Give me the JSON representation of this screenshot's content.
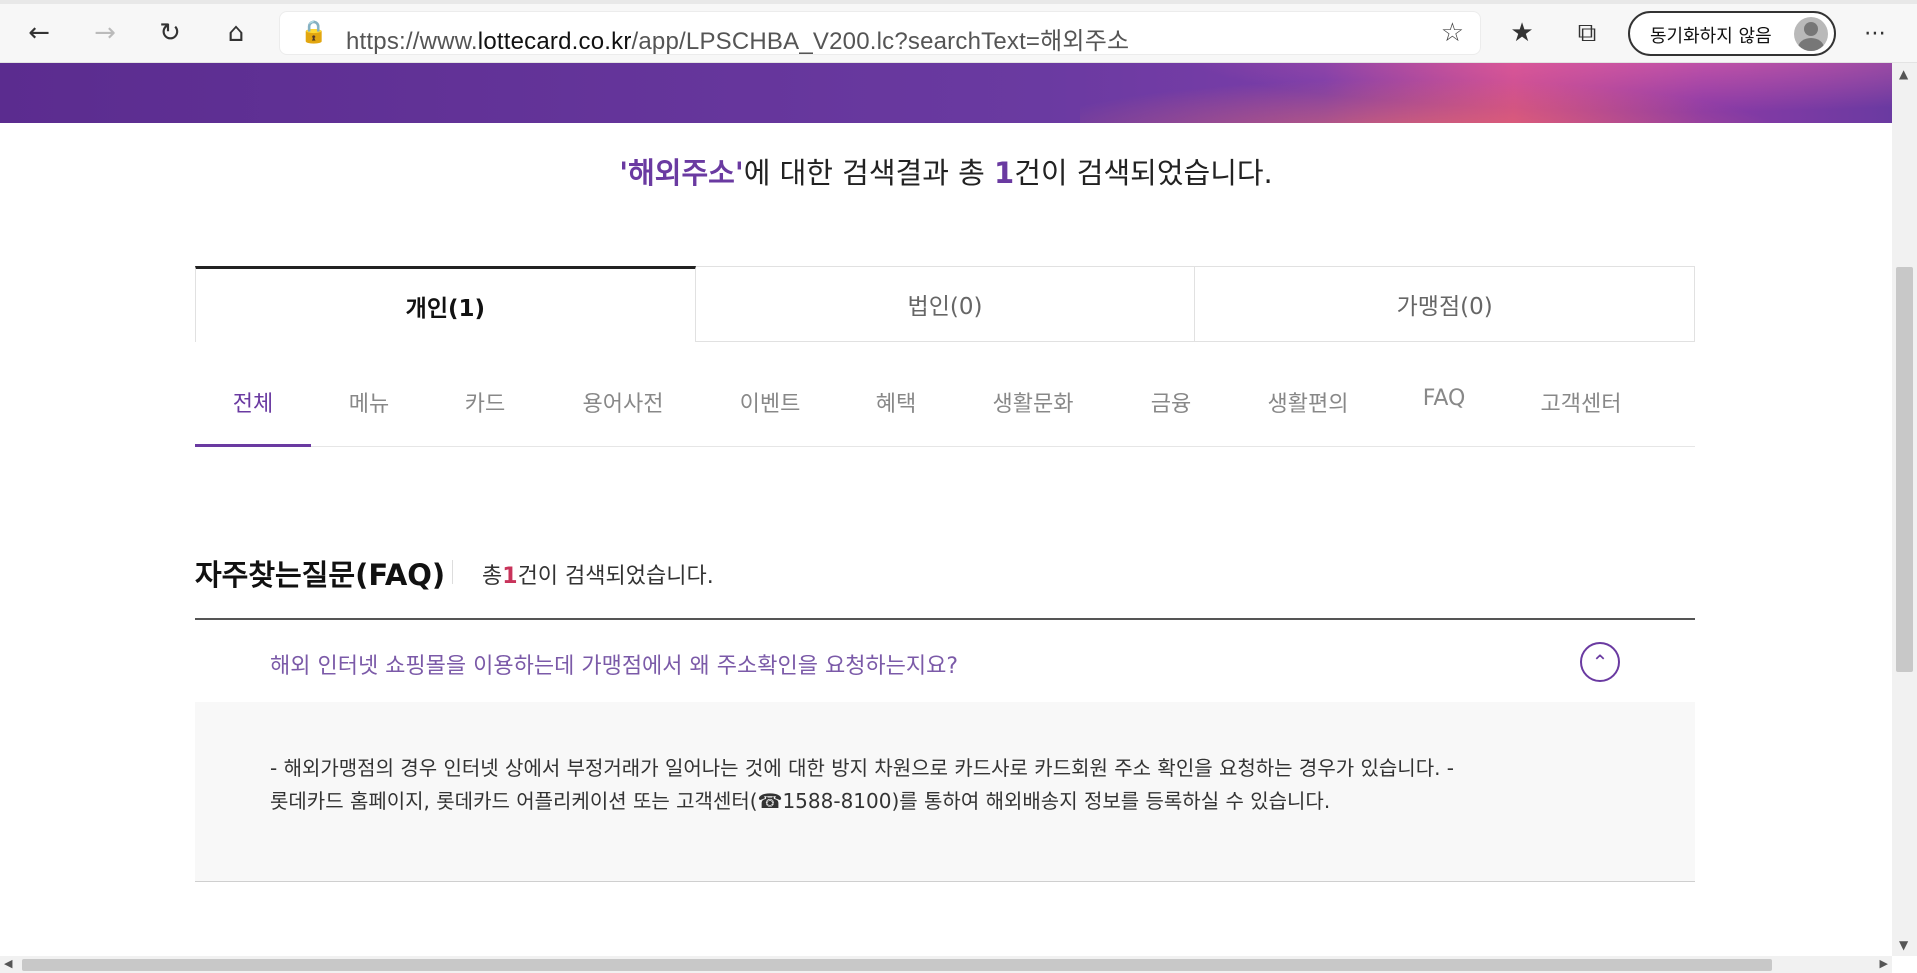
{
  "browser": {
    "url_prefix": "https://www.",
    "url_host": "lottecard.co.kr",
    "url_path": "/app/LPSCHBA_V200.lc?searchText=해외주소",
    "sync_label": "동기화하지 않음"
  },
  "result": {
    "keyword": "'해외주소'",
    "pre_count": "에 대한 검색결과 총 ",
    "count": "1",
    "post_count": "건이 검색되었습니다."
  },
  "tabs": [
    {
      "label": "개인(1)",
      "active": true
    },
    {
      "label": "법인(0)",
      "active": false
    },
    {
      "label": "가맹점(0)",
      "active": false
    }
  ],
  "subnav": [
    "전체",
    "메뉴",
    "카드",
    "용어사전",
    "이벤트",
    "혜택",
    "생활문화",
    "금융",
    "생활편의",
    "FAQ",
    "고객센터"
  ],
  "faq_section": {
    "title": "자주찾는질문(FAQ)",
    "count_pre": "총",
    "count": "1",
    "count_post": "건이 검색되었습니다."
  },
  "faq_items": [
    {
      "question": "해외 인터넷 쇼핑몰을 이용하는데 가맹점에서 왜 주소확인을 요청하는지요?",
      "answer_line1": "- 해외가맹점의 경우 인터넷 상에서 부정거래가 일어나는 것에 대한 방지 차원으로 카드사로 카드회원 주소 확인을 요청하는 경우가 있습니다. -",
      "answer_line2": "롯데카드 홈페이지, 롯데카드 어플리케이션 또는 고객센터(☎1588-8100)를 통하여 해외배송지 정보를 등록하실 수 있습니다."
    }
  ],
  "colors": {
    "accent": "#6a3aa1",
    "count_red": "#c8335a"
  }
}
